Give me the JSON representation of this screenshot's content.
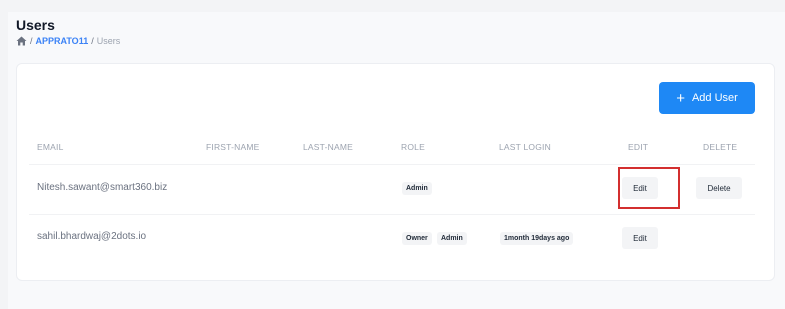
{
  "page": {
    "title": "Users"
  },
  "breadcrumb": {
    "sep1": "/",
    "project": "APPRATO11",
    "sep2": "/",
    "current": "Users"
  },
  "toolbar": {
    "add_icon": "+",
    "add_label": "Add User"
  },
  "table": {
    "headers": {
      "email": "EMAIL",
      "first_name": "FIRST-NAME",
      "last_name": "LAST-NAME",
      "role": "ROLE",
      "last_login": "LAST LOGIN",
      "edit": "EDIT",
      "delete": "DELETE"
    },
    "rows": [
      {
        "email": "Nitesh.sawant@smart360.biz",
        "roles": [
          "Admin"
        ],
        "last_login": "",
        "edit": "Edit",
        "delete": "Delete"
      },
      {
        "email": "sahil.bhardwaj@2dots.io",
        "roles": [
          "Owner",
          "Admin"
        ],
        "last_login": "1month 19days ago",
        "edit": "Edit"
      }
    ]
  },
  "colors": {
    "accent": "#1e88f5",
    "highlight": "#d32f2f",
    "link": "#3b82f6"
  },
  "icons": {
    "home": "home-icon",
    "add": "plus-icon"
  }
}
